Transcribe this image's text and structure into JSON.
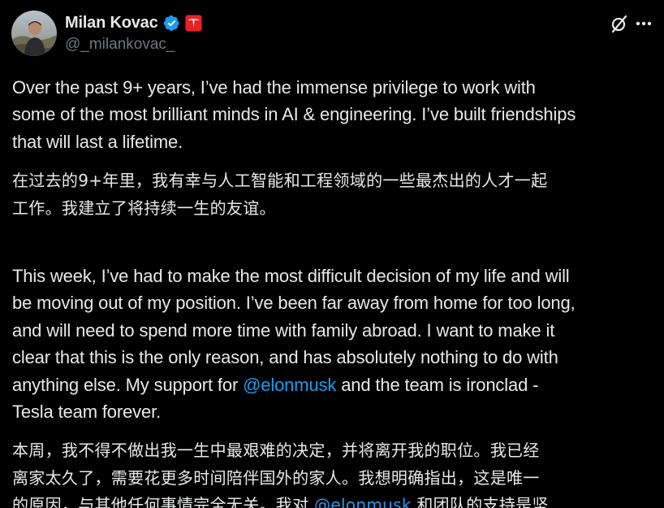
{
  "author": {
    "display_name": "Milan Kovac",
    "handle": "@_milankovac_",
    "avatar_icon": "profile-photo",
    "verified_icon": "verified-badge-icon",
    "affiliate_icon": "tesla-logo-icon"
  },
  "actions": {
    "grok_icon": "grok-icon",
    "more_icon": "more-icon"
  },
  "colors": {
    "background": "#000000",
    "text": "#e7e9ea",
    "secondary": "#71767b",
    "link": "#1d9bf0",
    "verified": "#1d9bf0",
    "affiliate": "#e82127"
  },
  "post": {
    "p1": [
      "Over the past 9+ years, I’ve had the immense privilege to work with",
      "some of the most brilliant minds in AI & engineering. I’ve built friendships",
      "that will last a lifetime."
    ],
    "p1_zh": [
      "在过去的9+年里，我有幸与人工智能和工程领域的一些最杰出的人才一起",
      "工作。我建立了将持续一生的友谊。"
    ],
    "p2": [
      "This week, I’ve had to make the most difficult decision of my life and will",
      "be moving out of my position. I’ve been far away from home for too long,",
      "and will need to spend more time with family abroad. I want to make it",
      "clear that this is the only reason, and has absolutely nothing to do with"
    ],
    "p2_l5_pre": "anything else. My support for ",
    "p2_l5_mention": "@elonmusk",
    "p2_l5_post": " and the team is ironclad -",
    "p2_l6": "Tesla team forever.",
    "p2_zh": [
      "本周，我不得不做出我一生中最艰难的决定，并将离开我的职位。我已经",
      "离家太久了，需要花更多时间陪伴国外的家人。我想明确指出，这是唯一"
    ],
    "p2_zh_l3_pre": "的原因，与其他任何事情完全无关。我对 ",
    "p2_zh_l3_mention": "@elonmusk",
    "p2_zh_l3_post": " 和团队的支持是坚"
  }
}
